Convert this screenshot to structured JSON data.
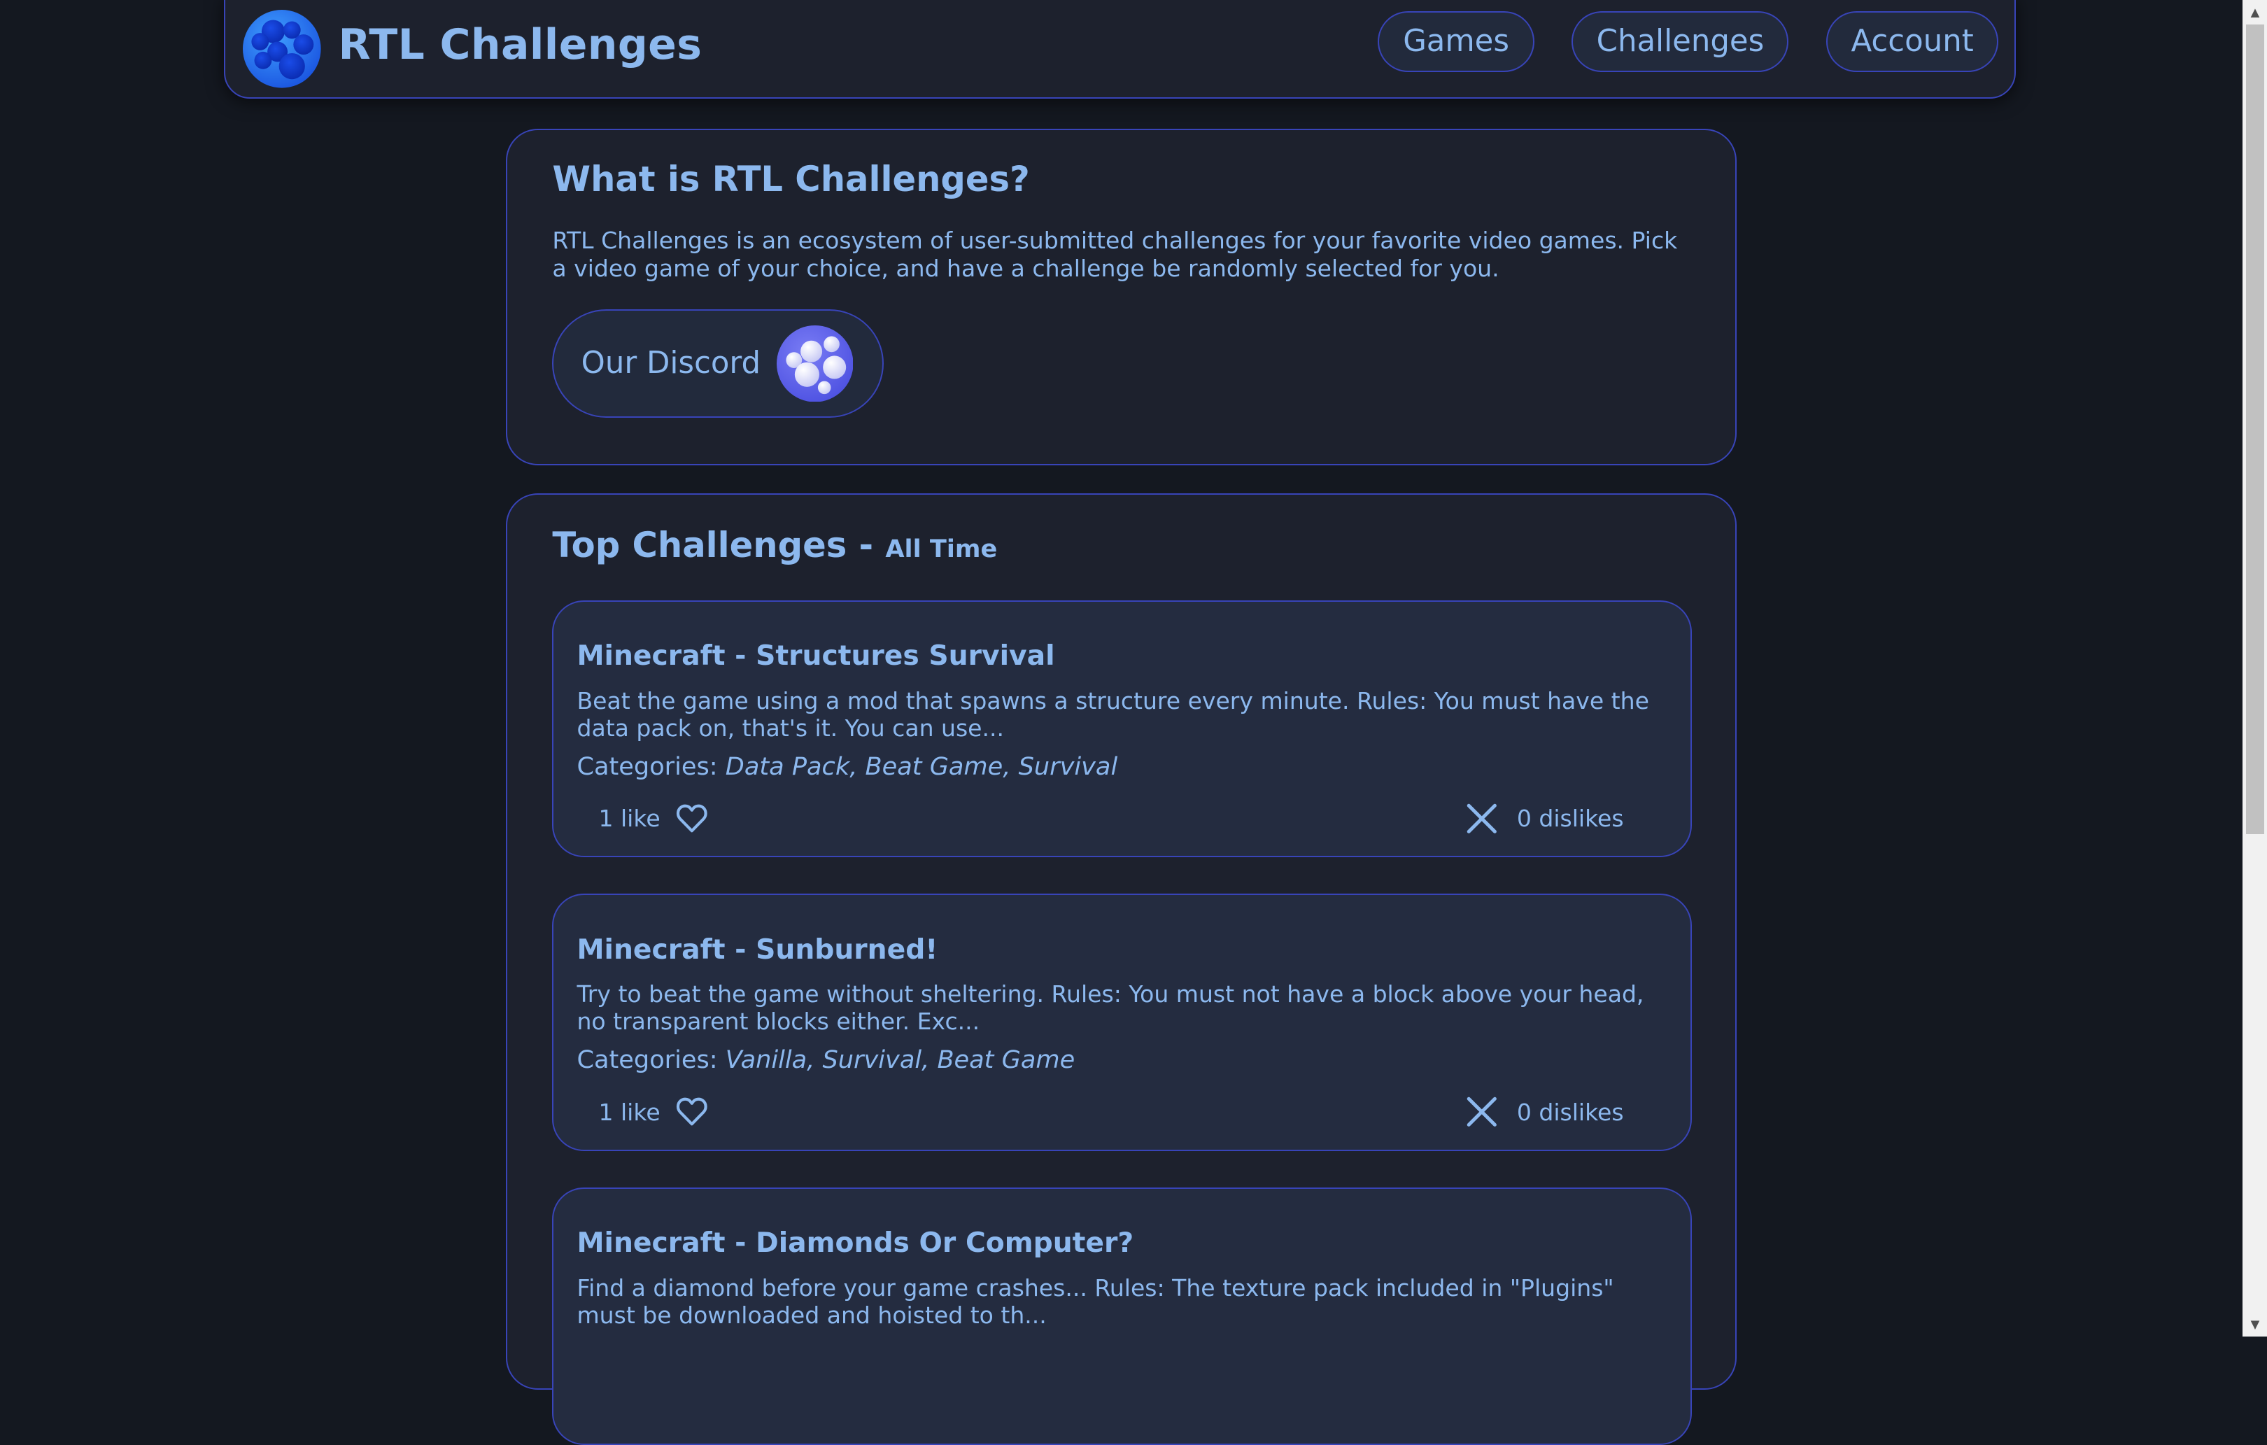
{
  "header": {
    "title": "RTL Challenges",
    "nav": [
      {
        "label": "Games"
      },
      {
        "label": "Challenges"
      },
      {
        "label": "Account"
      }
    ]
  },
  "about": {
    "title": "What is RTL Challenges?",
    "text": "RTL Challenges is an ecosystem of user-submitted challenges for your favorite video games. Pick a video game of your choice, and have a challenge be randomly selected for you.",
    "discord_label": "Our Discord"
  },
  "top": {
    "title": "Top Challenges - ",
    "period": "All Time",
    "categories_label": "Categories: ",
    "challenges": [
      {
        "title": "Minecraft - Structures Survival",
        "description": "Beat the game using a mod that spawns a structure every minute. Rules: You must have the data pack on, that's it. You can use...",
        "categories": "Data Pack, Beat Game, Survival",
        "likes": "1 like",
        "dislikes": "0 dislikes"
      },
      {
        "title": "Minecraft - Sunburned!",
        "description": "Try to beat the game without sheltering. Rules: You must not have a block above your head, no transparent blocks either. Exc...",
        "categories": "Vanilla, Survival, Beat Game",
        "likes": "1 like",
        "dislikes": "0 dislikes"
      },
      {
        "title": "Minecraft - Diamonds Or Computer?",
        "description": "Find a diamond before your game crashes... Rules: The texture pack included in \"Plugins\" must be downloaded and hoisted to th..."
      }
    ]
  },
  "colors": {
    "background": "#141820",
    "card": "#1d212d",
    "challenge_card": "#242c40",
    "border": "#3844b8",
    "text": "#8cb8ee"
  },
  "icons": {
    "logo": "bubbles-logo-icon",
    "discord": "bubbles-icon",
    "like": "heart-icon",
    "dislike": "x-icon"
  }
}
